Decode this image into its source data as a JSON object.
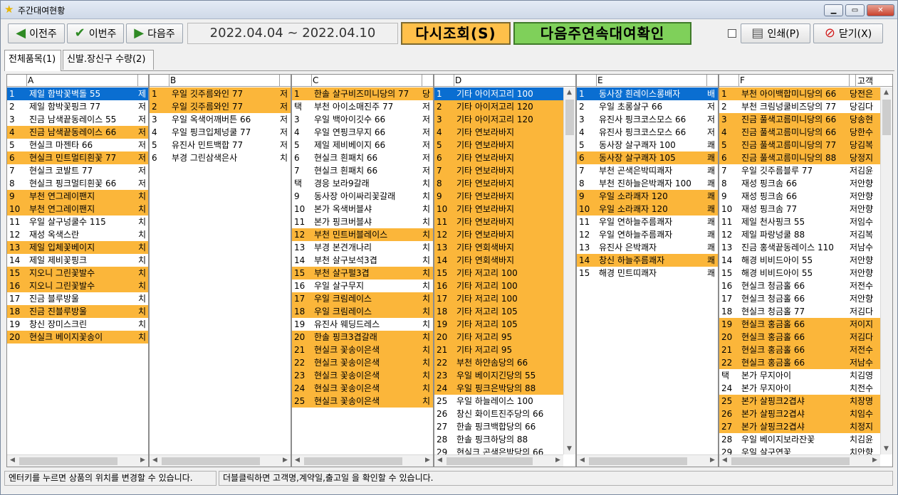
{
  "window": {
    "title": "주간대여현황"
  },
  "toolbar": {
    "prev": "이전주",
    "this": "이번주",
    "next": "다음주",
    "date_range": "2022.04.04 ~ 2022.04.10",
    "requery": "다시조회(S)",
    "next_confirm": "다음주연속대여확인",
    "print": "인쇄(P)",
    "close": "닫기(X)"
  },
  "tabs": [
    "전체품목(1)",
    "신발.장신구 수량(2)"
  ],
  "grids": [
    {
      "letter": "A",
      "rows": [
        [
          "1",
          "제일 함박꽃벽돌 55",
          "제",
          "sel"
        ],
        [
          "2",
          "제일 함박꽃핑크 77",
          "저",
          ""
        ],
        [
          "3",
          "진금 남색끝동레이스 55",
          "저",
          ""
        ],
        [
          "4",
          "진금 남색끝동레이스 66",
          "저",
          "o"
        ],
        [
          "5",
          "현실크 마젠타 66",
          "저",
          ""
        ],
        [
          "6",
          "현실크 민트멀티흰꽃 77",
          "저",
          "o"
        ],
        [
          "7",
          "현실크 코발트 77",
          "저",
          ""
        ],
        [
          "8",
          "현실크 핑크멀티흰꽃 66",
          "저",
          ""
        ],
        [
          "9",
          "부천 연그레이팬지",
          "치",
          "o"
        ],
        [
          "10",
          "부천 연그레이팬지",
          "치",
          "o"
        ],
        [
          "11",
          "우일 살구넝쿨수 115",
          "치",
          ""
        ],
        [
          "12",
          "재성 옥색스란",
          "치",
          ""
        ],
        [
          "13",
          "제일 입체꽃베이지",
          "치",
          "o"
        ],
        [
          "14",
          "제일 제비꽃핑크",
          "치",
          ""
        ],
        [
          "15",
          "지오니 그린꽃발수",
          "치",
          "o"
        ],
        [
          "16",
          "지오니 그린꽃발수",
          "치",
          "o"
        ],
        [
          "17",
          "진금 블루방울",
          "치",
          ""
        ],
        [
          "18",
          "진금 진블루방울",
          "치",
          "o"
        ],
        [
          "19",
          "창신 장미스크린",
          "치",
          ""
        ],
        [
          "20",
          "현실크 베이지꽃송이",
          "치",
          "o"
        ]
      ]
    },
    {
      "letter": "B",
      "rows": [
        [
          "1",
          "우일 깃주름와인 77",
          "저",
          "o"
        ],
        [
          "2",
          "우일 깃주름와인 77",
          "저",
          "o"
        ],
        [
          "3",
          "우일 옥색어깨버튼 66",
          "저",
          ""
        ],
        [
          "4",
          "우일 핑크입체넝쿨 77",
          "저",
          ""
        ],
        [
          "5",
          "유진사 민트백합 77",
          "저",
          ""
        ],
        [
          "6",
          "부경 그린삼색은사",
          "치",
          ""
        ]
      ]
    },
    {
      "letter": "C",
      "rows": [
        [
          "1",
          "한솔 살구비즈미니당의 77",
          "당",
          "o"
        ],
        [
          "택",
          "부천 아이소매진주 77",
          "저",
          ""
        ],
        [
          "3",
          "우일 백아이깃수 66",
          "저",
          ""
        ],
        [
          "4",
          "우일 연핑크무지 66",
          "저",
          ""
        ],
        [
          "5",
          "제일 제비베이지 66",
          "저",
          ""
        ],
        [
          "6",
          "현실크 흰패치 66",
          "저",
          ""
        ],
        [
          "7",
          "현실크 흰패치 66",
          "저",
          ""
        ],
        [
          "택",
          "경응 보라9갈래",
          "치",
          ""
        ],
        [
          "9",
          "동사장 아이싸리꽃갈래",
          "치",
          ""
        ],
        [
          "10",
          "본가 옥색버블샤",
          "치",
          ""
        ],
        [
          "11",
          "본가 핑크버블샤",
          "치",
          ""
        ],
        [
          "12",
          "부천 민트버블레이스",
          "치",
          "o"
        ],
        [
          "13",
          "부경 본견개나리",
          "치",
          ""
        ],
        [
          "14",
          "부천 살구보석3겹",
          "치",
          ""
        ],
        [
          "15",
          "부천 살구펄3겹",
          "치",
          "o"
        ],
        [
          "16",
          "우일 살구무지",
          "치",
          ""
        ],
        [
          "17",
          "우일 크림레이스",
          "치",
          "o"
        ],
        [
          "18",
          "우일 크림레이스",
          "치",
          "o"
        ],
        [
          "19",
          "유진사 웨딩드레스",
          "치",
          ""
        ],
        [
          "20",
          "한솔 핑크3겹갈래",
          "치",
          "o"
        ],
        [
          "21",
          "현실크 꽃송이은색",
          "치",
          "o"
        ],
        [
          "22",
          "현실크 꽃송이은색",
          "치",
          "o"
        ],
        [
          "23",
          "현실크 꽃송이은색",
          "치",
          "o"
        ],
        [
          "24",
          "현실크 꽃송이은색",
          "치",
          "o"
        ],
        [
          "25",
          "현실크 꽃송이은색",
          "치",
          "o"
        ]
      ]
    },
    {
      "letter": "D",
      "rows": [
        [
          "1",
          "기타 아이저고리 100",
          "",
          "sel"
        ],
        [
          "2",
          "기타 아이저고리 120",
          "",
          "o"
        ],
        [
          "3",
          "기타 아이저고리 120",
          "",
          "o"
        ],
        [
          "4",
          "기타 연보라바지",
          "",
          "o"
        ],
        [
          "5",
          "기타 연보라바지",
          "",
          "o"
        ],
        [
          "6",
          "기타 연보라바지",
          "",
          "o"
        ],
        [
          "7",
          "기타 연보라바지",
          "",
          "o"
        ],
        [
          "8",
          "기타 연보라바지",
          "",
          "o"
        ],
        [
          "9",
          "기타 연보라바지",
          "",
          "o"
        ],
        [
          "10",
          "기타 연보라바지",
          "",
          "o"
        ],
        [
          "11",
          "기타 연보라바지",
          "",
          "o"
        ],
        [
          "12",
          "기타 연보라바지",
          "",
          "o"
        ],
        [
          "13",
          "기타 연회색바지",
          "",
          "o"
        ],
        [
          "14",
          "기타 연회색바지",
          "",
          "o"
        ],
        [
          "15",
          "기타 저고리 100",
          "",
          "o"
        ],
        [
          "16",
          "기타 저고리 100",
          "",
          "o"
        ],
        [
          "17",
          "기타 저고리 100",
          "",
          "o"
        ],
        [
          "18",
          "기타 저고리 105",
          "",
          "o"
        ],
        [
          "19",
          "기타 저고리 105",
          "",
          "o"
        ],
        [
          "20",
          "기타 저고리 95",
          "",
          "o"
        ],
        [
          "21",
          "기타 저고리 95",
          "",
          "o"
        ],
        [
          "22",
          "부천 하얀솜당의 66",
          "",
          "o"
        ],
        [
          "23",
          "우일 베이지긴당의 55",
          "",
          "o"
        ],
        [
          "24",
          "우일 핑크은박당의 88",
          "",
          "o"
        ],
        [
          "25",
          "우일 하늘레이스 100",
          "",
          ""
        ],
        [
          "26",
          "창신 화이트진주당의 66",
          "",
          ""
        ],
        [
          "27",
          "한솔 핑크백합당의 66",
          "",
          ""
        ],
        [
          "28",
          "한솔 핑크하당의 88",
          "",
          ""
        ],
        [
          "29",
          "현실크 곤색은박당의 66",
          "",
          ""
        ]
      ]
    },
    {
      "letter": "E",
      "rows": [
        [
          "1",
          "동사장 흰레이스롱배자",
          "배",
          "sel"
        ],
        [
          "2",
          "우일 초롱살구 66",
          "저",
          ""
        ],
        [
          "3",
          "유진사 핑크코스모스 66",
          "저",
          ""
        ],
        [
          "4",
          "유진사 핑크코스모스 66",
          "저",
          ""
        ],
        [
          "5",
          "동사장 살구쾌자 100",
          "쾌",
          ""
        ],
        [
          "6",
          "동사장 살구쾌자 105",
          "쾌",
          "o"
        ],
        [
          "7",
          "부천 곤색은박띠쾌자",
          "쾌",
          ""
        ],
        [
          "8",
          "부천 진하늘은박쾌자 100",
          "쾌",
          ""
        ],
        [
          "9",
          "우일 소라쾌자 120",
          "쾌",
          "o"
        ],
        [
          "10",
          "우일 소라쾌자 120",
          "쾌",
          "o"
        ],
        [
          "11",
          "우일 연하늘주름쾌자",
          "쾌",
          ""
        ],
        [
          "12",
          "우일 연하늘주름쾌자",
          "쾌",
          ""
        ],
        [
          "13",
          "유진사 은박쾌자",
          "쾌",
          ""
        ],
        [
          "14",
          "창신 하늘주름쾌자",
          "쾌",
          "o"
        ],
        [
          "15",
          "해경 민트띠쾌자",
          "쾌",
          ""
        ]
      ]
    },
    {
      "letter": "F",
      "extra": "고객",
      "rows": [
        [
          "1",
          "부천 아이백합미니당의 66",
          "당",
          "전은",
          "o"
        ],
        [
          "2",
          "부천 크림넝쿨비즈당의 77",
          "당",
          "김다",
          ""
        ],
        [
          "3",
          "진금 풀색고름미니당의 66",
          "당",
          "송현",
          "o"
        ],
        [
          "4",
          "진금 풀색고름미니당의 66",
          "당",
          "한수",
          "o"
        ],
        [
          "5",
          "진금 풀색고름미니당의 77",
          "당",
          "김복",
          "o"
        ],
        [
          "6",
          "진금 풀색고름미니당의 88",
          "당",
          "정지",
          "o"
        ],
        [
          "7",
          "우일 깃주름블루 77",
          "저",
          "김윤",
          ""
        ],
        [
          "8",
          "재성 핑크솜 66",
          "저",
          "안향",
          ""
        ],
        [
          "9",
          "재성 핑크솜 66",
          "저",
          "안향",
          ""
        ],
        [
          "10",
          "재성 핑크솜 77",
          "저",
          "안향",
          ""
        ],
        [
          "11",
          "제일 천사핑크 55",
          "저",
          "임수",
          ""
        ],
        [
          "12",
          "제일 파랑넝쿨 88",
          "저",
          "김복",
          ""
        ],
        [
          "13",
          "진금 홍색끝동레이스 110",
          "저",
          "남수",
          ""
        ],
        [
          "14",
          "해경 비비드아이 55",
          "저",
          "안향",
          ""
        ],
        [
          "15",
          "해경 비비드아이 55",
          "저",
          "안향",
          ""
        ],
        [
          "16",
          "현실크 청금홀 66",
          "저",
          "전수",
          ""
        ],
        [
          "17",
          "현실크 청금홀 66",
          "저",
          "안향",
          ""
        ],
        [
          "18",
          "현실크 청금홀 77",
          "저",
          "김다",
          ""
        ],
        [
          "19",
          "현실크 홍금홀 66",
          "저",
          "이지",
          "o"
        ],
        [
          "20",
          "현실크 홍금홀 66",
          "저",
          "김다",
          "o"
        ],
        [
          "21",
          "현실크 홍금홀 66",
          "저",
          "전수",
          "o"
        ],
        [
          "22",
          "현실크 홍금홀 66",
          "저",
          "남수",
          "o"
        ],
        [
          "택",
          "본가 무지아이",
          "치",
          "김영",
          ""
        ],
        [
          "24",
          "본가 무지아이",
          "치",
          "전수",
          ""
        ],
        [
          "25",
          "본가 살핑크2겹샤",
          "치",
          "장명",
          "o"
        ],
        [
          "26",
          "본가 살핑크2겹샤",
          "치",
          "임수",
          "o"
        ],
        [
          "27",
          "본가 살핑크2겹샤",
          "치",
          "정지",
          "o"
        ],
        [
          "28",
          "우일 베이지보라잔꽃",
          "치",
          "김윤",
          ""
        ],
        [
          "29",
          "우일 살구연꽃",
          "치",
          "안향",
          ""
        ]
      ]
    }
  ],
  "status": {
    "left": "엔터키를 누르면 상품의 위치를 변경할 수 있습니다.",
    "right": "더블클릭하면 고객명,계약일,출고일 을 확인할 수 있습니다."
  },
  "colors": {
    "orange": "#fbb63a",
    "select": "#0a6ed1",
    "requery": "#ffc04a",
    "next_confirm": "#7fd05a"
  }
}
